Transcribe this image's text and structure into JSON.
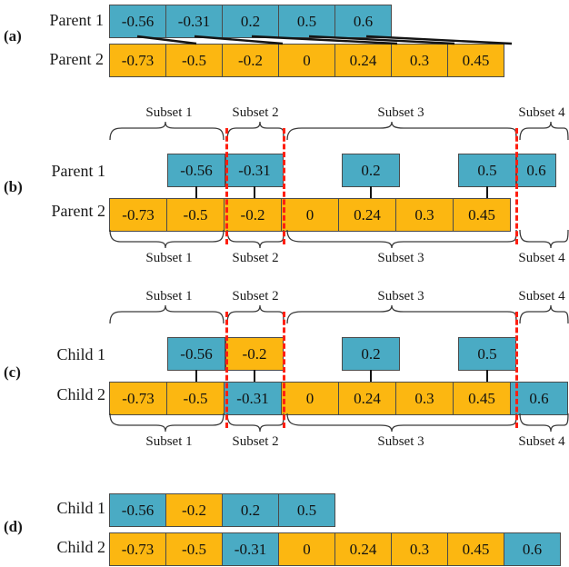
{
  "figure": {
    "title": "Subset-based crossover operator illustration",
    "colors": {
      "teal": "#4aabc4",
      "orange": "#fcb711",
      "dashed_line": "#ff1f10",
      "border": "#4b4b4b"
    }
  },
  "panels": [
    {
      "tag": "(a)",
      "rows": [
        {
          "label": "Parent 1",
          "color": "teal",
          "values": [
            "-0.56",
            "-0.31",
            "0.2",
            "0.5",
            "0.6"
          ]
        },
        {
          "label": "Parent 2",
          "color": "orange",
          "values": [
            "-0.73",
            "-0.5",
            "-0.2",
            "0",
            "0.24",
            "0.3",
            "0.45"
          ]
        }
      ]
    },
    {
      "tag": "(b)",
      "rows": [
        {
          "label": "Parent 1",
          "blocks": [
            {
              "value": "-0.56",
              "color": "teal"
            },
            {
              "value": "-0.31",
              "color": "teal"
            },
            {
              "value": "0.2",
              "color": "teal"
            },
            {
              "value": "0.5",
              "color": "teal"
            },
            {
              "value": "0.6",
              "color": "teal"
            }
          ]
        },
        {
          "label": "Parent 2",
          "color": "orange",
          "values": [
            "-0.73",
            "-0.5",
            "-0.2",
            "0",
            "0.24",
            "0.3",
            "0.45"
          ]
        }
      ],
      "subsets_top": [
        "Subset 1",
        "Subset 2",
        "Subset 3",
        "Subset 4"
      ],
      "subsets_bottom": [
        "Subset 1",
        "Subset 2",
        "Subset 3",
        "Subset 4"
      ]
    },
    {
      "tag": "(c)",
      "rows": [
        {
          "label": "Child 1",
          "blocks": [
            {
              "value": "-0.56",
              "color": "teal"
            },
            {
              "value": "-0.2",
              "color": "orange"
            },
            {
              "value": "0.2",
              "color": "teal"
            },
            {
              "value": "0.5",
              "color": "teal"
            }
          ]
        },
        {
          "label": "Child 2",
          "cells": [
            {
              "value": "-0.73",
              "color": "orange"
            },
            {
              "value": "-0.5",
              "color": "orange"
            },
            {
              "value": "-0.31",
              "color": "teal"
            },
            {
              "value": "0",
              "color": "orange"
            },
            {
              "value": "0.24",
              "color": "orange"
            },
            {
              "value": "0.3",
              "color": "orange"
            },
            {
              "value": "0.45",
              "color": "orange"
            },
            {
              "value": "0.6",
              "color": "teal"
            }
          ]
        }
      ],
      "subsets_top": [
        "Subset 1",
        "Subset 2",
        "Subset 3",
        "Subset 4"
      ],
      "subsets_bottom": [
        "Subset 1",
        "Subset 2",
        "Subset 3",
        "Subset 4"
      ]
    },
    {
      "tag": "(d)",
      "rows": [
        {
          "label": "Child 1",
          "cells": [
            {
              "value": "-0.56",
              "color": "teal"
            },
            {
              "value": "-0.2",
              "color": "orange"
            },
            {
              "value": "0.2",
              "color": "teal"
            },
            {
              "value": "0.5",
              "color": "teal"
            }
          ]
        },
        {
          "label": "Child 2",
          "cells": [
            {
              "value": "-0.73",
              "color": "orange"
            },
            {
              "value": "-0.5",
              "color": "orange"
            },
            {
              "value": "-0.31",
              "color": "teal"
            },
            {
              "value": "0",
              "color": "orange"
            },
            {
              "value": "0.24",
              "color": "orange"
            },
            {
              "value": "0.3",
              "color": "orange"
            },
            {
              "value": "0.45",
              "color": "orange"
            },
            {
              "value": "0.6",
              "color": "teal"
            }
          ]
        }
      ]
    }
  ]
}
